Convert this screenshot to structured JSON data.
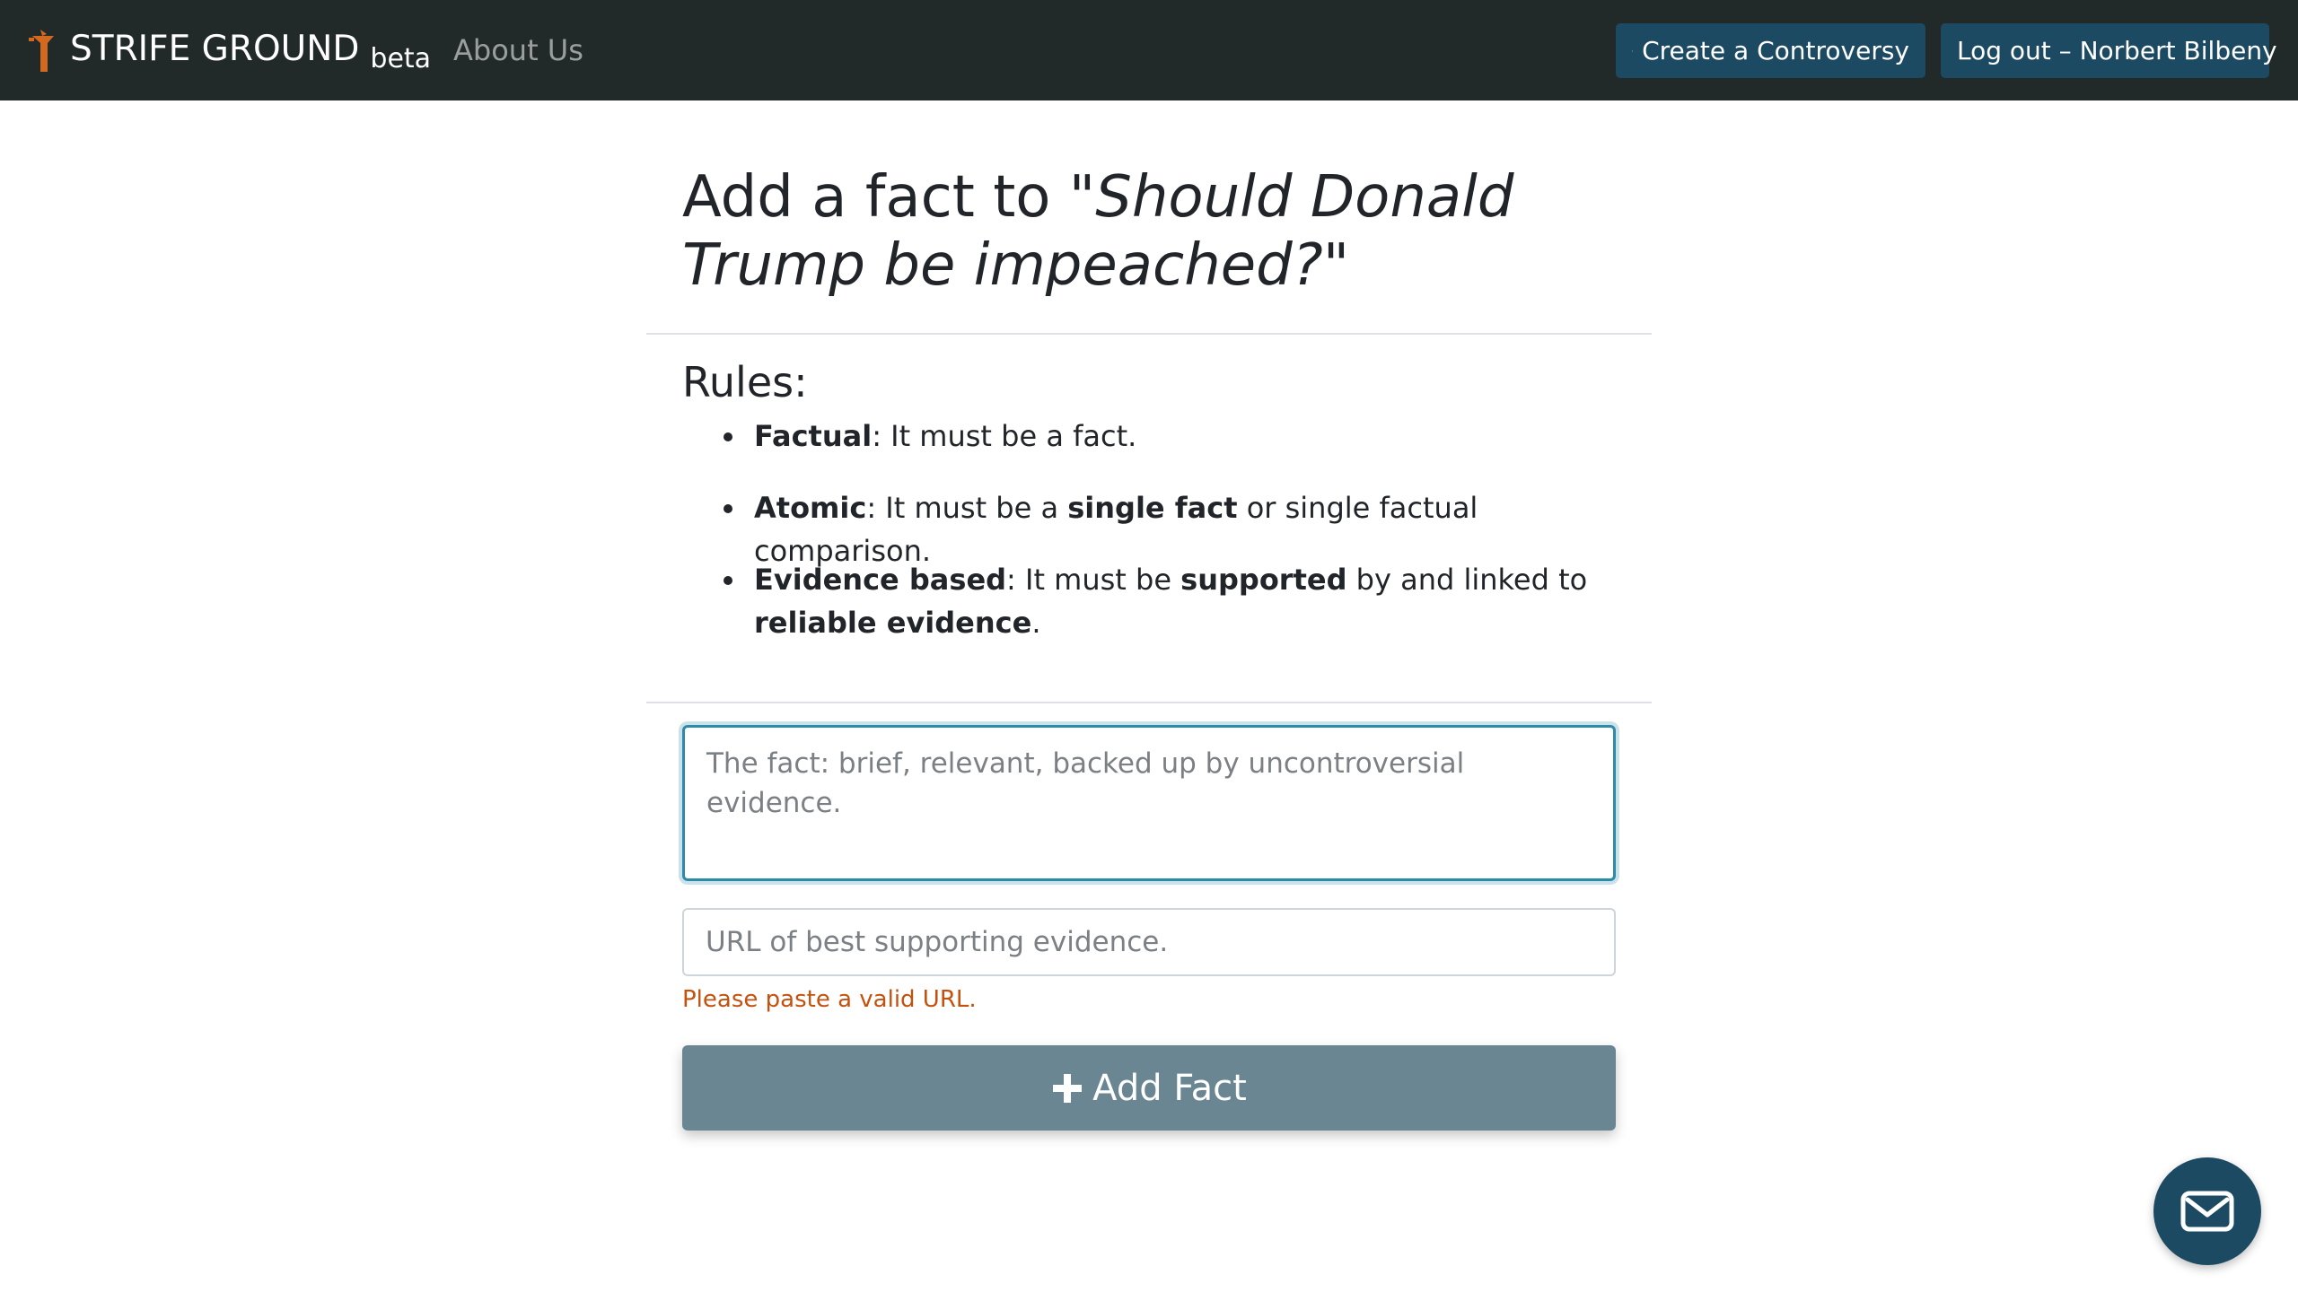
{
  "navbar": {
    "brand_name": "STRIFE GROUND",
    "brand_badge": "beta",
    "about_link": "About Us",
    "create_button": "Create a Controversy",
    "logout_button": "Log out – Norbert Bilbeny",
    "logo_icon": "torch-logo-icon",
    "colors": {
      "background": "#212a28",
      "button": "#1d4a63",
      "logo": "#d2691e"
    }
  },
  "page": {
    "title_prefix": "Add a fact to ",
    "title_question": "\"Should Donald Trump be impeached?\""
  },
  "rules": {
    "heading": "Rules:",
    "items": [
      {
        "term": "Factual",
        "parts": [
          ": It must be a fact."
        ]
      },
      {
        "term": "Atomic",
        "parts": [
          ": It must be a ",
          "single fact",
          " or single factual comparison."
        ]
      },
      {
        "term": "Evidence based",
        "parts": [
          ": It must be ",
          "supported",
          " by and linked to ",
          "reliable evidence",
          "."
        ]
      }
    ]
  },
  "form": {
    "fact_placeholder": "The fact: brief, relevant, backed up by uncontroversial evidence.",
    "fact_value": "",
    "url_placeholder": "URL of best supporting evidence.",
    "url_value": "",
    "url_error": "Please paste a valid URL.",
    "submit_label": "Add Fact",
    "colors": {
      "submit": "#6a8692",
      "error": "#c4520e",
      "focus": "#2d8aa8"
    }
  },
  "fab": {
    "icon": "mail-icon"
  }
}
